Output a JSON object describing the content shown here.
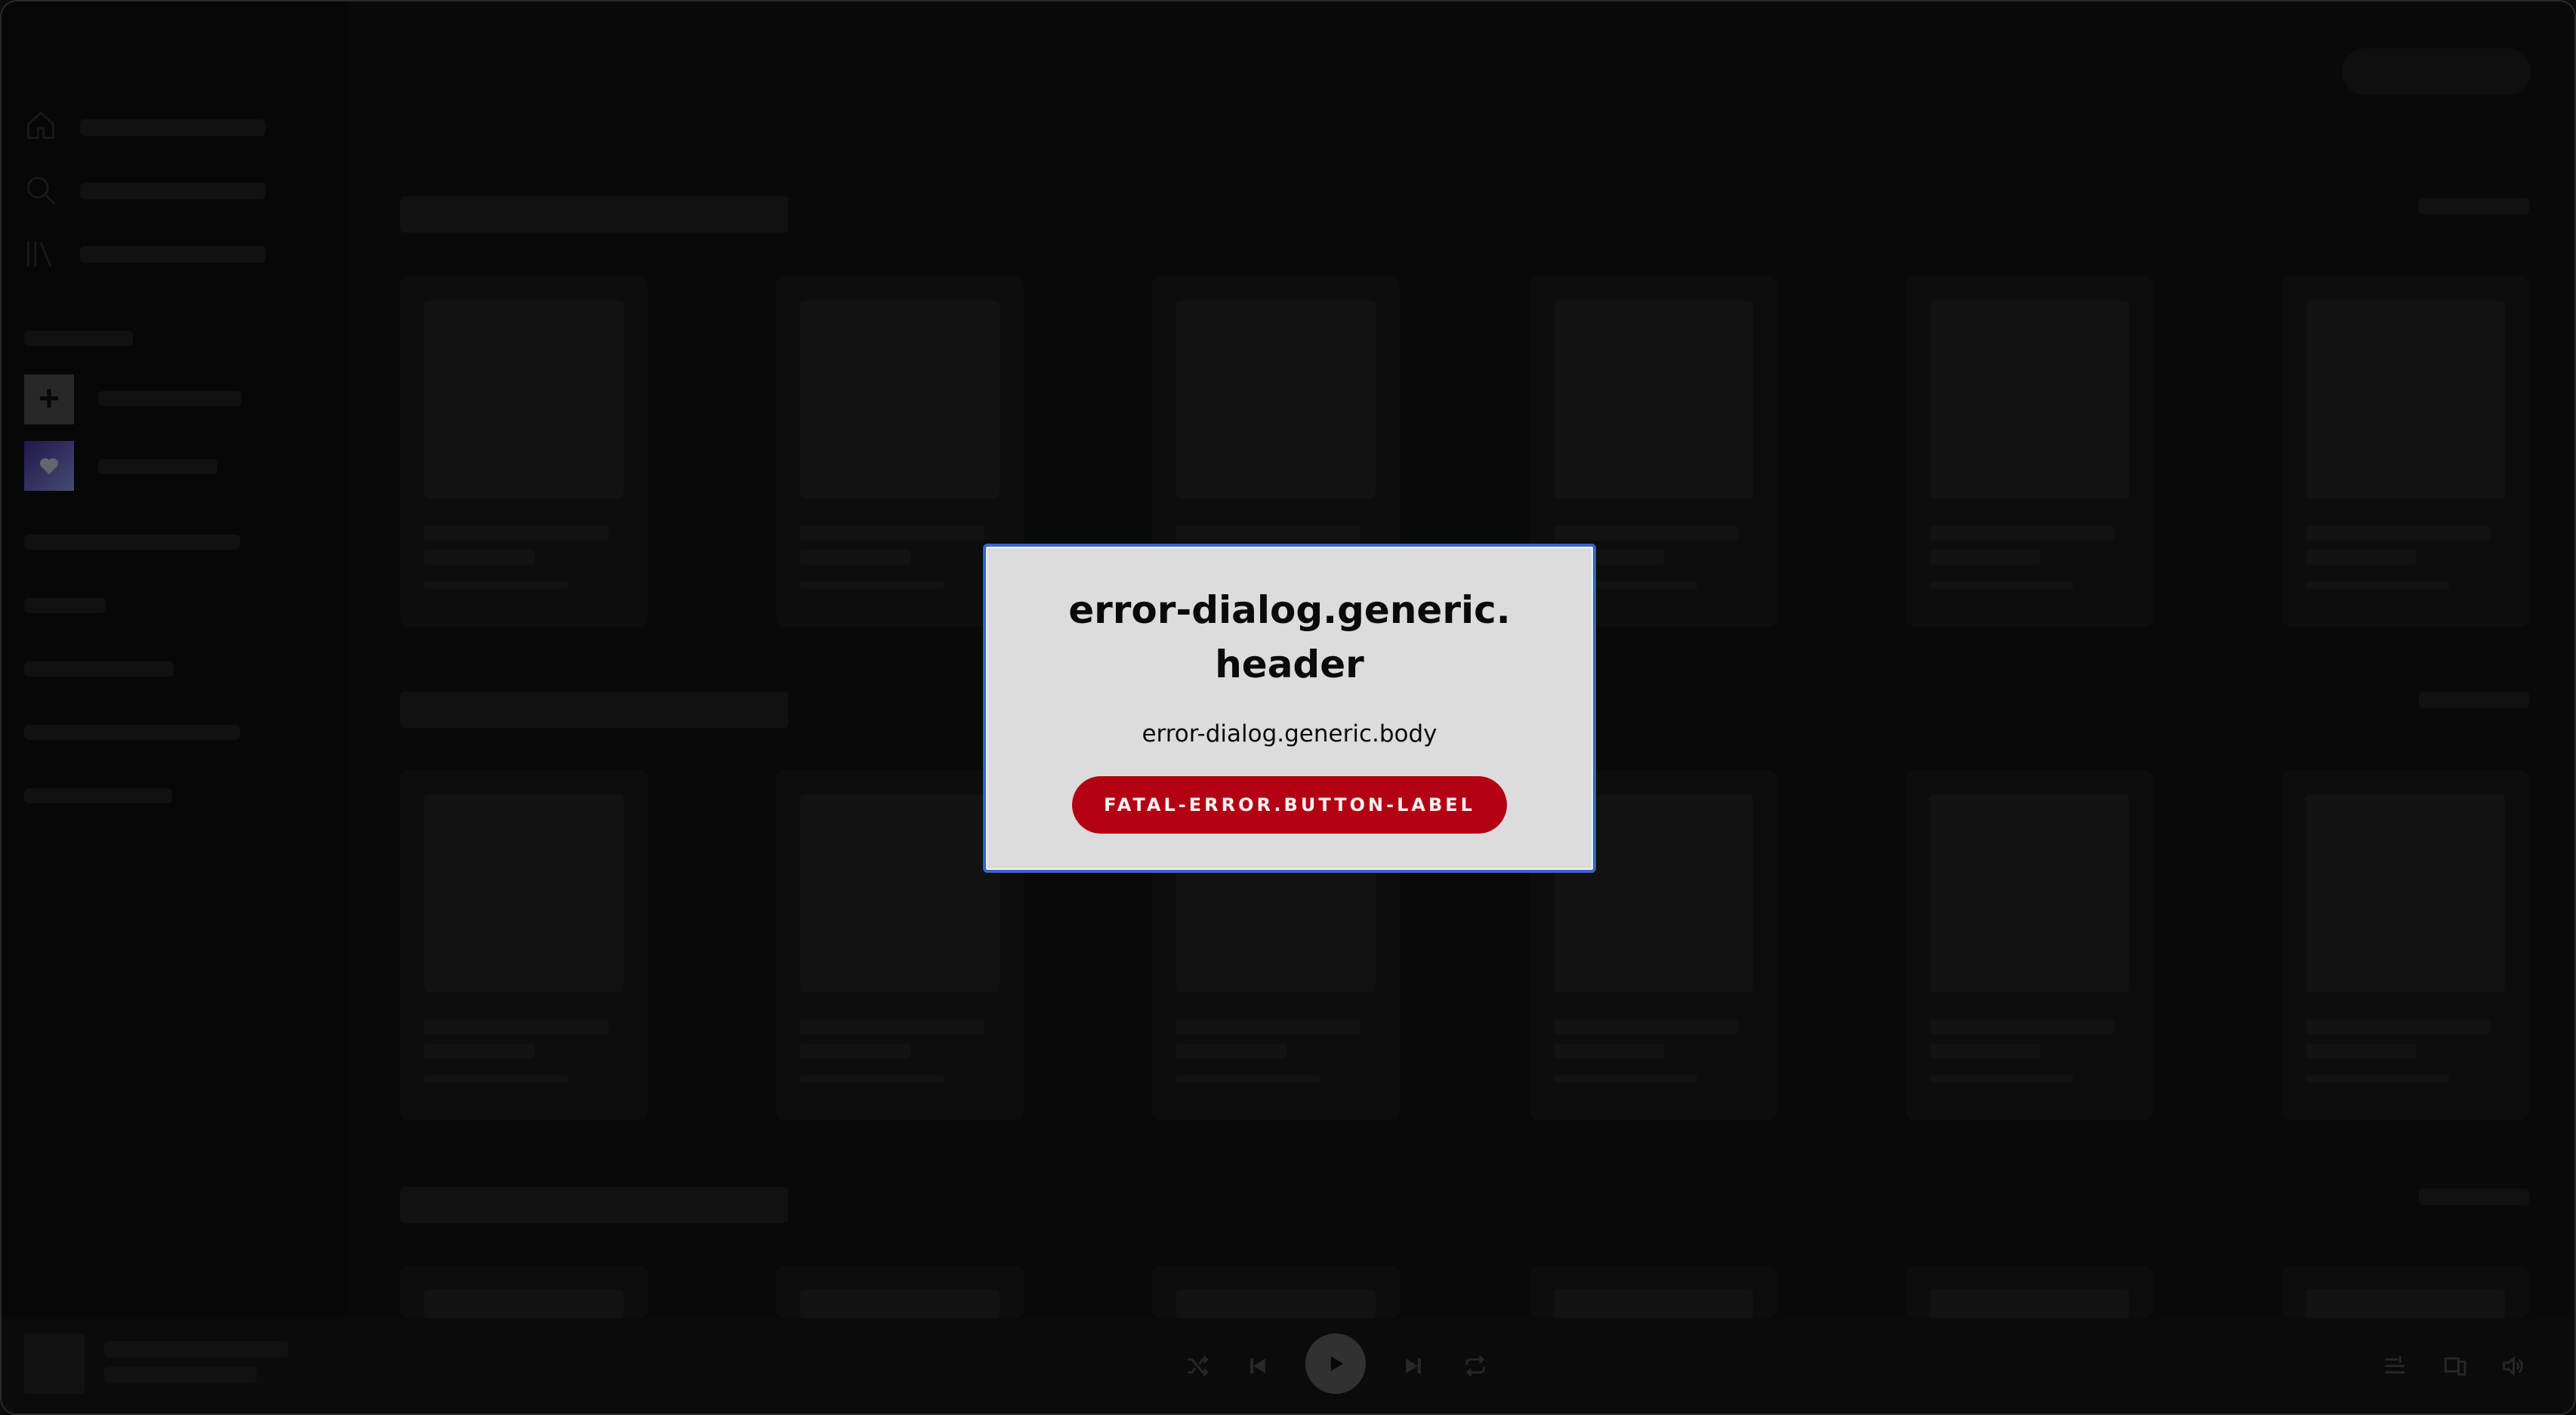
{
  "window": {
    "traffic_lights": [
      "close",
      "minimize",
      "maximize"
    ]
  },
  "sidebar": {
    "nav_icons": [
      "home-icon",
      "search-icon",
      "library-icon"
    ],
    "create_playlist_icon": "plus-icon",
    "liked_songs_icon": "heart-icon"
  },
  "player": {
    "controls": [
      "shuffle-icon",
      "previous-icon",
      "play-icon",
      "next-icon",
      "repeat-icon"
    ],
    "right_controls": [
      "queue-icon",
      "connect-device-icon",
      "volume-icon"
    ]
  },
  "dialog": {
    "header": "error-dialog.generic.header",
    "body": "error-dialog.generic.body",
    "button_label": "FATAL-ERROR.BUTTON-LABEL",
    "button_color": "#b30012",
    "focus_border_color": "#3866c8"
  }
}
